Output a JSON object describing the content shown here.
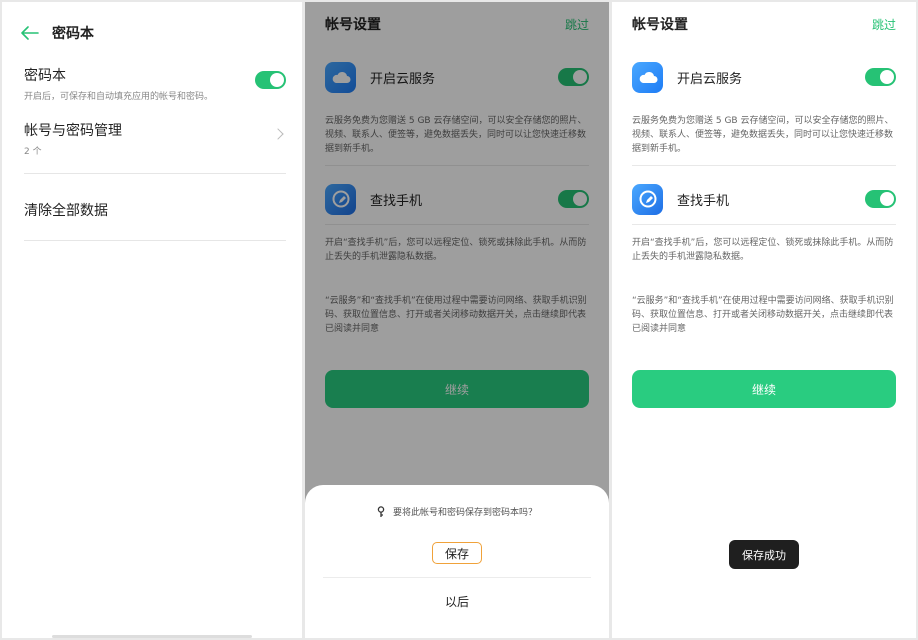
{
  "passbook_settings": {
    "title": "密码本",
    "password_book": {
      "label": "密码本",
      "subtitle": "开启后，可保存和自动填充应用的帐号和密码。",
      "enabled": true
    },
    "account_manage": {
      "label": "帐号与密码管理",
      "count": "2 个"
    },
    "clear_all": "清除全部数据"
  },
  "account_setup": {
    "title": "帐号设置",
    "skip": "跳过",
    "cloud": {
      "label": "开启云服务",
      "enabled": true,
      "description": "云服务免费为您赠送 5 GB 云存储空间，可以安全存储您的照片、视频、联系人、便签等，避免数据丢失，同时可以让您快速迁移数据到新手机。"
    },
    "find_phone": {
      "label": "查找手机",
      "enabled": true,
      "description": "开启“查找手机”后，您可以远程定位、锁死或抹除此手机。从而防止丢失的手机泄露隐私数据。"
    },
    "notice": "“云服务”和“查找手机”在使用过程中需要访问网络、获取手机识别码、获取位置信息、打开或者关闭移动数据开关，点击继续即代表已阅读并同意",
    "continue": "继续"
  },
  "save_prompt": {
    "question": "要将此帐号和密码保存到密码本吗？",
    "save": "保存",
    "later": "以后"
  },
  "toast": "保存成功",
  "colors": {
    "accent_green": "#26c275",
    "button_green": "#29cc80",
    "icon_blue": "#1e7cf5",
    "highlight_orange": "#f0a23a"
  }
}
